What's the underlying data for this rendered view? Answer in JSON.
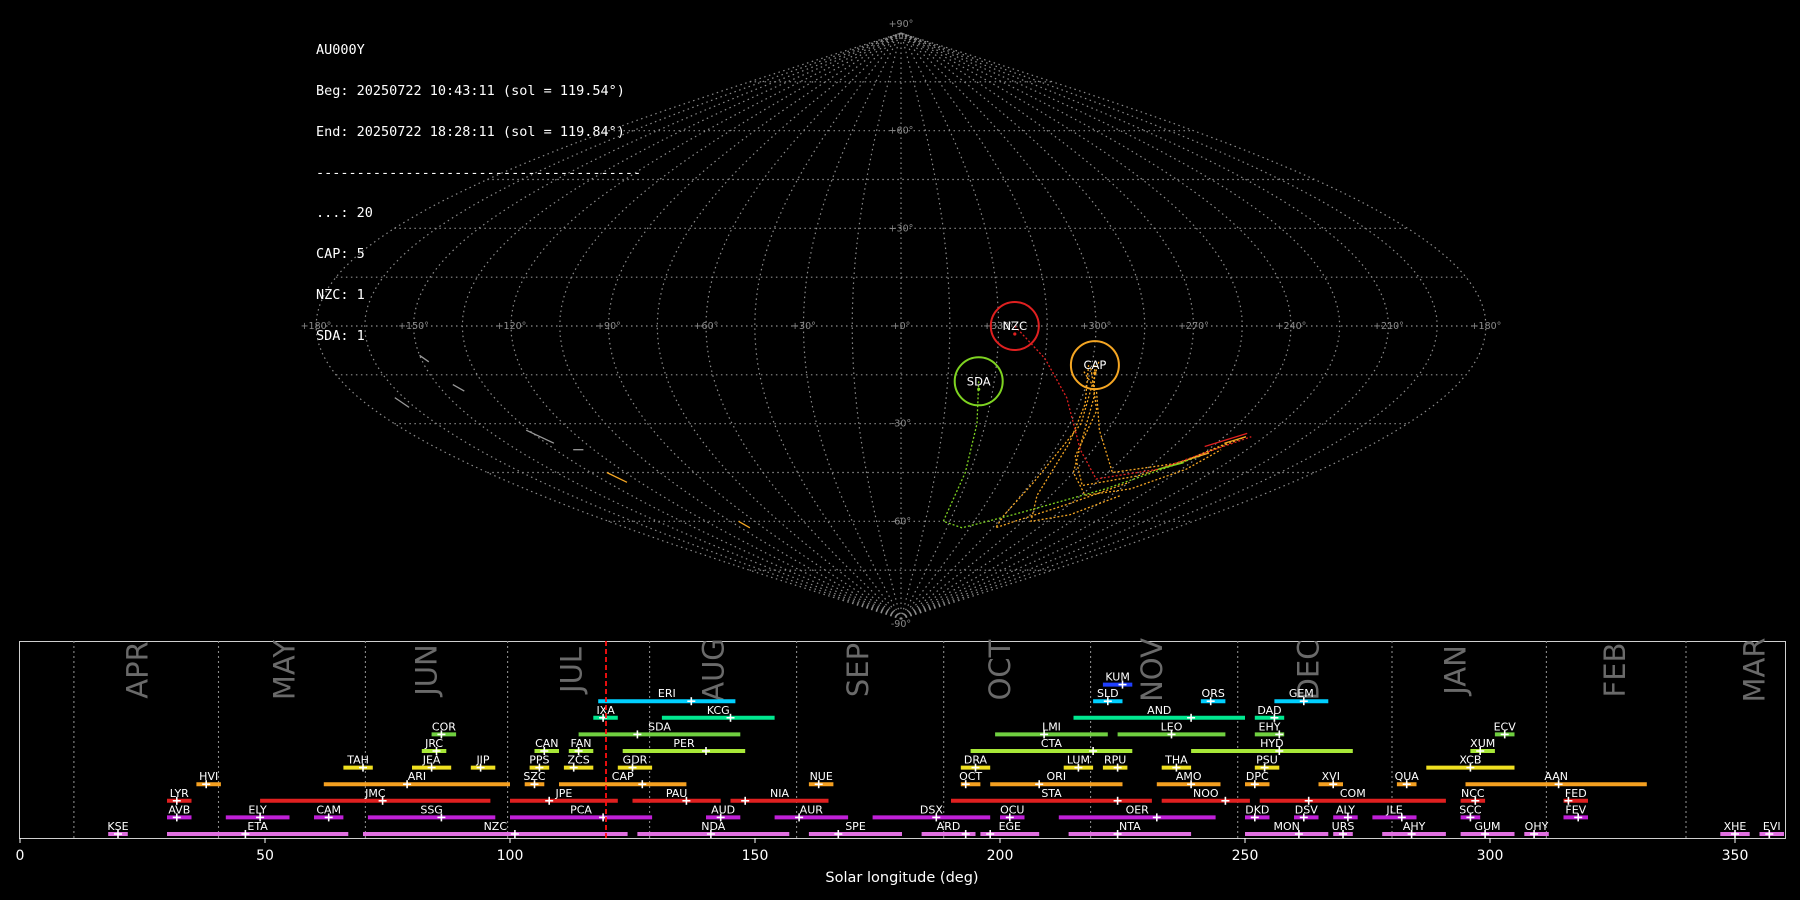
{
  "stats": {
    "station": "AU000Y",
    "beg": "Beg: 20250722 10:43:11 (sol = 119.54°)",
    "end": "End: 20250722 18:28:11 (sol = 119.84°)",
    "separator": "----------------------------------------",
    "counts": [
      "...: 20",
      "CAP: 5",
      "NZC: 1",
      "SDA: 1"
    ]
  },
  "chart_data": [
    {
      "type": "scatter",
      "projection": "sinusoidal",
      "grid": true,
      "lon_tick_labels": [
        "+180°",
        "+150°",
        "+120°",
        "+90°",
        "+60°",
        "+30°",
        "+0°",
        "+330°",
        "+300°",
        "+270°",
        "+240°",
        "+210°",
        "+180°"
      ],
      "lat_tick_labels": [
        "+90°",
        "+60°",
        "+30°",
        "-30°",
        "-60°",
        "-90°"
      ],
      "shower_circles": [
        {
          "code": "NZC",
          "lon": 325,
          "lat": 0,
          "color": "#e02020"
        },
        {
          "code": "CAP",
          "lon": 299,
          "lat": -12,
          "color": "#f5a623"
        },
        {
          "code": "SDA",
          "lon": 335,
          "lat": -17,
          "color": "#7ed321"
        }
      ]
    },
    {
      "type": "bar",
      "xlabel": "Solar longitude (deg)",
      "xlim": [
        0,
        360
      ],
      "x_ticks": [
        0,
        50,
        100,
        150,
        200,
        250,
        300,
        350
      ],
      "current_sol": 119.6,
      "months": [
        {
          "label": "APR",
          "pos": 24,
          "divider": 11
        },
        {
          "label": "MAY",
          "pos": 54,
          "divider": 40.5
        },
        {
          "label": "JUN",
          "pos": 83,
          "divider": 70.5
        },
        {
          "label": "JUL",
          "pos": 112.5,
          "divider": 99.5
        },
        {
          "label": "AUG",
          "pos": 141.5,
          "divider": 128.5
        },
        {
          "label": "SEP",
          "pos": 171,
          "divider": 158.5
        },
        {
          "label": "OCT",
          "pos": 200,
          "divider": 188.5
        },
        {
          "label": "NOV",
          "pos": 231,
          "divider": 218.5
        },
        {
          "label": "DEC",
          "pos": 263,
          "divider": 248.5
        },
        {
          "label": "JAN",
          "pos": 293,
          "divider": 280
        },
        {
          "label": "FEB",
          "pos": 325.5,
          "divider": 311.5
        },
        {
          "label": "MAR",
          "pos": 354,
          "divider": 340
        }
      ],
      "showers": [
        {
          "code": "KUM",
          "start": 221,
          "end": 227,
          "peak": 225,
          "row": 9,
          "color": "#1f3fff"
        },
        {
          "code": "ERI",
          "start": 118,
          "end": 146,
          "peak": 137,
          "row": 8,
          "color": "#00d0ff"
        },
        {
          "code": "SLD",
          "start": 219,
          "end": 225,
          "peak": 222,
          "row": 8,
          "color": "#00d0ff"
        },
        {
          "code": "ORS",
          "start": 241,
          "end": 246,
          "peak": 243,
          "row": 8,
          "color": "#00d0ff"
        },
        {
          "code": "GEM",
          "start": 256,
          "end": 267,
          "peak": 262,
          "row": 8,
          "color": "#00d0ff"
        },
        {
          "code": "IXA",
          "start": 117,
          "end": 122,
          "peak": 119,
          "row": 7,
          "color": "#00e890"
        },
        {
          "code": "KCG",
          "start": 131,
          "end": 154,
          "peak": 145,
          "row": 7,
          "color": "#00e890"
        },
        {
          "code": "AND",
          "start": 215,
          "end": 250,
          "peak": 239,
          "row": 7,
          "color": "#00e890"
        },
        {
          "code": "DAD",
          "start": 252,
          "end": 258,
          "peak": 256,
          "row": 7,
          "color": "#00e890"
        },
        {
          "code": "COR",
          "start": 84,
          "end": 89,
          "peak": 86,
          "row": 6,
          "color": "#70d040"
        },
        {
          "code": "SDA",
          "start": 114,
          "end": 147,
          "peak": 126,
          "row": 6,
          "color": "#70d040"
        },
        {
          "code": "LMI",
          "start": 199,
          "end": 222,
          "peak": 209,
          "row": 6,
          "color": "#70d040"
        },
        {
          "code": "LEO",
          "start": 224,
          "end": 246,
          "peak": 235,
          "row": 6,
          "color": "#70d040"
        },
        {
          "code": "EHY",
          "start": 252,
          "end": 258,
          "peak": 257,
          "row": 6,
          "color": "#70d040"
        },
        {
          "code": "ECV",
          "start": 301,
          "end": 305,
          "peak": 303,
          "row": 6,
          "color": "#70d040"
        },
        {
          "code": "JRC",
          "start": 82,
          "end": 87,
          "peak": 85,
          "row": 5,
          "color": "#a8e838"
        },
        {
          "code": "CAN",
          "start": 105,
          "end": 110,
          "peak": 107,
          "row": 5,
          "color": "#a8e838"
        },
        {
          "code": "FAN",
          "start": 112,
          "end": 117,
          "peak": 114,
          "row": 5,
          "color": "#a8e838"
        },
        {
          "code": "PER",
          "start": 123,
          "end": 148,
          "peak": 140,
          "row": 5,
          "color": "#a8e838"
        },
        {
          "code": "CTA",
          "start": 194,
          "end": 227,
          "peak": 219,
          "row": 5,
          "color": "#a8e838"
        },
        {
          "code": "HYD",
          "start": 239,
          "end": 272,
          "peak": 257,
          "row": 5,
          "color": "#a8e838"
        },
        {
          "code": "XUM",
          "start": 296,
          "end": 301,
          "peak": 298,
          "row": 5,
          "color": "#a8e838"
        },
        {
          "code": "TAH",
          "start": 66,
          "end": 72,
          "peak": 70,
          "row": 4,
          "color": "#f0e020"
        },
        {
          "code": "JEA",
          "start": 80,
          "end": 88,
          "peak": 84,
          "row": 4,
          "color": "#f0e020"
        },
        {
          "code": "JIP",
          "start": 92,
          "end": 97,
          "peak": 94,
          "row": 4,
          "color": "#f0e020"
        },
        {
          "code": "PPS",
          "start": 104,
          "end": 108,
          "peak": 106,
          "row": 4,
          "color": "#f0e020"
        },
        {
          "code": "ZCS",
          "start": 111,
          "end": 117,
          "peak": 113,
          "row": 4,
          "color": "#f0e020"
        },
        {
          "code": "GDR",
          "start": 122,
          "end": 129,
          "peak": 125,
          "row": 4,
          "color": "#f0e020"
        },
        {
          "code": "DRA",
          "start": 192,
          "end": 198,
          "peak": 195,
          "row": 4,
          "color": "#f0e020"
        },
        {
          "code": "LUM",
          "start": 213,
          "end": 219,
          "peak": 216,
          "row": 4,
          "color": "#f0e020"
        },
        {
          "code": "RPU",
          "start": 221,
          "end": 226,
          "peak": 224,
          "row": 4,
          "color": "#f0e020"
        },
        {
          "code": "THA",
          "start": 233,
          "end": 239,
          "peak": 236,
          "row": 4,
          "color": "#f0e020"
        },
        {
          "code": "PSU",
          "start": 252,
          "end": 257,
          "peak": 254,
          "row": 4,
          "color": "#f0e020"
        },
        {
          "code": "XCB",
          "start": 287,
          "end": 305,
          "peak": 296,
          "row": 4,
          "color": "#f0e020"
        },
        {
          "code": "HVI",
          "start": 36,
          "end": 41,
          "peak": 38,
          "row": 3,
          "color": "#f5a020"
        },
        {
          "code": "ARI",
          "start": 62,
          "end": 100,
          "peak": 79,
          "row": 3,
          "color": "#f5a020"
        },
        {
          "code": "SZC",
          "start": 103,
          "end": 107,
          "peak": 105,
          "row": 3,
          "color": "#f5a020"
        },
        {
          "code": "CAP",
          "start": 110,
          "end": 136,
          "peak": 127,
          "row": 3,
          "color": "#f5a020"
        },
        {
          "code": "NUE",
          "start": 161,
          "end": 166,
          "peak": 163,
          "row": 3,
          "color": "#f5a020"
        },
        {
          "code": "OCT",
          "start": 192,
          "end": 196,
          "peak": 193,
          "row": 3,
          "color": "#f5a020"
        },
        {
          "code": "ORI",
          "start": 198,
          "end": 225,
          "peak": 208,
          "row": 3,
          "color": "#f5a020"
        },
        {
          "code": "AMO",
          "start": 232,
          "end": 245,
          "peak": 239,
          "row": 3,
          "color": "#f5a020"
        },
        {
          "code": "DPC",
          "start": 250,
          "end": 255,
          "peak": 252,
          "row": 3,
          "color": "#f5a020"
        },
        {
          "code": "XVI",
          "start": 265,
          "end": 270,
          "peak": 268,
          "row": 3,
          "color": "#f5a020"
        },
        {
          "code": "QUA",
          "start": 281,
          "end": 285,
          "peak": 283,
          "row": 3,
          "color": "#f5a020"
        },
        {
          "code": "AAN",
          "start": 295,
          "end": 332,
          "peak": 314,
          "row": 3,
          "color": "#f5a020"
        },
        {
          "code": "LYR",
          "start": 30,
          "end": 35,
          "peak": 32,
          "row": 2,
          "color": "#e02020"
        },
        {
          "code": "JMC",
          "start": 49,
          "end": 96,
          "peak": 74,
          "row": 2,
          "color": "#e02020"
        },
        {
          "code": "JPE",
          "start": 100,
          "end": 122,
          "peak": 108,
          "row": 2,
          "color": "#e02020"
        },
        {
          "code": "PAU",
          "start": 125,
          "end": 143,
          "peak": 136,
          "row": 2,
          "color": "#e02020"
        },
        {
          "code": "NIA",
          "start": 145,
          "end": 165,
          "peak": 148,
          "row": 2,
          "color": "#e02020"
        },
        {
          "code": "STA",
          "start": 190,
          "end": 231,
          "peak": 224,
          "row": 2,
          "color": "#e02020"
        },
        {
          "code": "NOO",
          "start": 233,
          "end": 251,
          "peak": 246,
          "row": 2,
          "color": "#e02020"
        },
        {
          "code": "COM",
          "start": 253,
          "end": 291,
          "peak": 263,
          "row": 2,
          "color": "#e02020"
        },
        {
          "code": "NCC",
          "start": 294,
          "end": 299,
          "peak": 297,
          "row": 2,
          "color": "#e02020"
        },
        {
          "code": "FED",
          "start": 315,
          "end": 320,
          "peak": 316,
          "row": 2,
          "color": "#e02020"
        },
        {
          "code": "AVB",
          "start": 30,
          "end": 35,
          "peak": 32,
          "row": 1,
          "color": "#c020d8"
        },
        {
          "code": "ELY",
          "start": 42,
          "end": 55,
          "peak": 49,
          "row": 1,
          "color": "#c020d8"
        },
        {
          "code": "CAM",
          "start": 60,
          "end": 66,
          "peak": 63,
          "row": 1,
          "color": "#c020d8"
        },
        {
          "code": "SSG",
          "start": 71,
          "end": 97,
          "peak": 86,
          "row": 1,
          "color": "#c020d8"
        },
        {
          "code": "PCA",
          "start": 100,
          "end": 129,
          "peak": 119,
          "row": 1,
          "color": "#c020d8"
        },
        {
          "code": "AUD",
          "start": 140,
          "end": 147,
          "peak": 143,
          "row": 1,
          "color": "#c020d8"
        },
        {
          "code": "AUR",
          "start": 154,
          "end": 169,
          "peak": 159,
          "row": 1,
          "color": "#c020d8"
        },
        {
          "code": "DSX",
          "start": 174,
          "end": 198,
          "peak": 187,
          "row": 1,
          "color": "#c020d8"
        },
        {
          "code": "OCU",
          "start": 200,
          "end": 205,
          "peak": 202,
          "row": 1,
          "color": "#c020d8"
        },
        {
          "code": "OER",
          "start": 212,
          "end": 244,
          "peak": 232,
          "row": 1,
          "color": "#c020d8"
        },
        {
          "code": "DKD",
          "start": 250,
          "end": 255,
          "peak": 252,
          "row": 1,
          "color": "#c020d8"
        },
        {
          "code": "DSV",
          "start": 260,
          "end": 265,
          "peak": 262,
          "row": 1,
          "color": "#c020d8"
        },
        {
          "code": "ALY",
          "start": 268,
          "end": 273,
          "peak": 271,
          "row": 1,
          "color": "#c020d8"
        },
        {
          "code": "JLE",
          "start": 276,
          "end": 285,
          "peak": 282,
          "row": 1,
          "color": "#c020d8"
        },
        {
          "code": "SCC",
          "start": 294,
          "end": 298,
          "peak": 296,
          "row": 1,
          "color": "#c020d8"
        },
        {
          "code": "FEV",
          "start": 315,
          "end": 320,
          "peak": 318,
          "row": 1,
          "color": "#c020d8"
        },
        {
          "code": "KSE",
          "start": 18,
          "end": 22,
          "peak": 20,
          "row": 0,
          "color": "#e070e0"
        },
        {
          "code": "ETA",
          "start": 30,
          "end": 67,
          "peak": 46,
          "row": 0,
          "color": "#e070e0"
        },
        {
          "code": "NZC",
          "start": 70,
          "end": 124,
          "peak": 101,
          "row": 0,
          "color": "#e070e0"
        },
        {
          "code": "NDA",
          "start": 126,
          "end": 157,
          "peak": 141,
          "row": 0,
          "color": "#e070e0"
        },
        {
          "code": "SPE",
          "start": 161,
          "end": 180,
          "peak": 167,
          "row": 0,
          "color": "#e070e0"
        },
        {
          "code": "ARD",
          "start": 184,
          "end": 195,
          "peak": 193,
          "row": 0,
          "color": "#e070e0"
        },
        {
          "code": "EGE",
          "start": 196,
          "end": 208,
          "peak": 198,
          "row": 0,
          "color": "#e070e0"
        },
        {
          "code": "NTA",
          "start": 214,
          "end": 239,
          "peak": 224,
          "row": 0,
          "color": "#e070e0"
        },
        {
          "code": "MON",
          "start": 250,
          "end": 267,
          "peak": 261,
          "row": 0,
          "color": "#e070e0"
        },
        {
          "code": "URS",
          "start": 268,
          "end": 272,
          "peak": 270,
          "row": 0,
          "color": "#e070e0"
        },
        {
          "code": "AHY",
          "start": 278,
          "end": 291,
          "peak": 284,
          "row": 0,
          "color": "#e070e0"
        },
        {
          "code": "GUM",
          "start": 294,
          "end": 305,
          "peak": 299,
          "row": 0,
          "color": "#e070e0"
        },
        {
          "code": "OHY",
          "start": 307,
          "end": 312,
          "peak": 309,
          "row": 0,
          "color": "#e070e0"
        },
        {
          "code": "XHE",
          "start": 347,
          "end": 353,
          "peak": 350,
          "row": 0,
          "color": "#e070e0"
        },
        {
          "code": "EVI",
          "start": 355,
          "end": 360,
          "peak": 357,
          "row": 0,
          "color": "#e070e0"
        }
      ]
    }
  ]
}
